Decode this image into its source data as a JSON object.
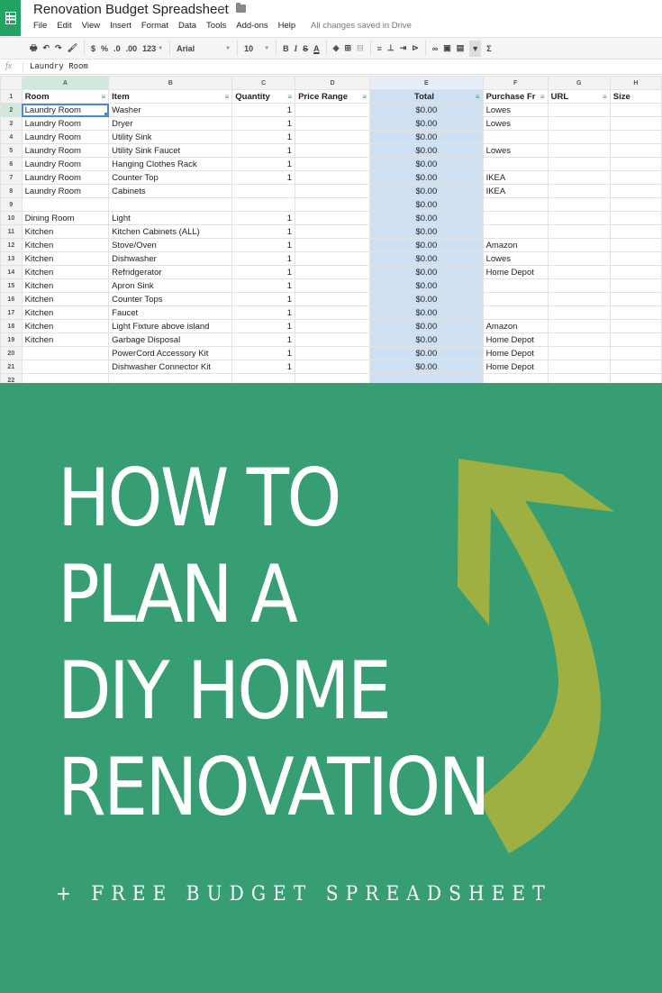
{
  "spreadsheet": {
    "title": "Renovation Budget Spreadsheet",
    "menu": [
      "File",
      "Edit",
      "View",
      "Insert",
      "Format",
      "Data",
      "Tools",
      "Add-ons",
      "Help"
    ],
    "save_status": "All changes saved in Drive",
    "toolbar": {
      "currency": "$",
      "percent": "%",
      "decrease_decimal": ".0",
      "increase_decimal": ".00",
      "more_formats": "123",
      "font": "Arial",
      "font_size": "10",
      "bold": "B",
      "italic": "I",
      "strikethrough": "S",
      "text_color": "A"
    },
    "formula_bar": {
      "fx_label": "fx",
      "value": "Laundry Room"
    },
    "column_letters": [
      "A",
      "B",
      "C",
      "D",
      "E",
      "F",
      "G",
      "H"
    ],
    "headers": [
      "Room",
      "Item",
      "Quantity",
      "Price Range",
      "Total",
      "Purchase Fr",
      "URL",
      "Size"
    ],
    "rows": [
      {
        "n": "2",
        "room": "Laundry Room",
        "item": "Washer",
        "qty": "1",
        "total": "$0.00",
        "from": "Lowes"
      },
      {
        "n": "3",
        "room": "Laundry Room",
        "item": "Dryer",
        "qty": "1",
        "total": "$0.00",
        "from": "Lowes"
      },
      {
        "n": "4",
        "room": "Laundry Room",
        "item": "Utility Sink",
        "qty": "1",
        "total": "$0.00",
        "from": ""
      },
      {
        "n": "5",
        "room": "Laundry Room",
        "item": "Utility Sink Faucet",
        "qty": "1",
        "total": "$0.00",
        "from": "Lowes"
      },
      {
        "n": "6",
        "room": "Laundry Room",
        "item": "Hanging Clothes Rack",
        "qty": "1",
        "total": "$0.00",
        "from": ""
      },
      {
        "n": "7",
        "room": "Laundry Room",
        "item": "Counter Top",
        "qty": "1",
        "total": "$0.00",
        "from": "IKEA"
      },
      {
        "n": "8",
        "room": "Laundry Room",
        "item": "Cabinets",
        "qty": "",
        "total": "$0.00",
        "from": "IKEA"
      },
      {
        "n": "9",
        "room": "",
        "item": "",
        "qty": "",
        "total": "$0.00",
        "from": ""
      },
      {
        "n": "10",
        "room": "Dining Room",
        "item": "Light",
        "qty": "1",
        "total": "$0.00",
        "from": ""
      },
      {
        "n": "11",
        "room": "Kitchen",
        "item": "Kitchen Cabinets (ALL)",
        "qty": "1",
        "total": "$0.00",
        "from": ""
      },
      {
        "n": "12",
        "room": "Kitchen",
        "item": "Stove/Oven",
        "qty": "1",
        "total": "$0.00",
        "from": "Amazon"
      },
      {
        "n": "13",
        "room": "Kitchen",
        "item": "Dishwasher",
        "qty": "1",
        "total": "$0.00",
        "from": "Lowes"
      },
      {
        "n": "14",
        "room": "Kitchen",
        "item": "Refridgerator",
        "qty": "1",
        "total": "$0.00",
        "from": "Home Depot"
      },
      {
        "n": "15",
        "room": "Kitchen",
        "item": "Apron Sink",
        "qty": "1",
        "total": "$0.00",
        "from": ""
      },
      {
        "n": "16",
        "room": "Kitchen",
        "item": "Counter Tops",
        "qty": "1",
        "total": "$0.00",
        "from": ""
      },
      {
        "n": "17",
        "room": "Kitchen",
        "item": "Faucet",
        "qty": "1",
        "total": "$0.00",
        "from": ""
      },
      {
        "n": "18",
        "room": "Kitchen",
        "item": "Light Fixture above island",
        "qty": "1",
        "total": "$0.00",
        "from": "Amazon"
      },
      {
        "n": "19",
        "room": "Kitchen",
        "item": "Garbage Disposal",
        "qty": "1",
        "total": "$0.00",
        "from": "Home Depot"
      },
      {
        "n": "20",
        "room": "",
        "item": "PowerCord Accessory Kit",
        "qty": "1",
        "total": "$0.00",
        "from": "Home Depot"
      },
      {
        "n": "21",
        "room": "",
        "item": "Dishwasher Connector Kit",
        "qty": "1",
        "total": "$0.00",
        "from": "Home Depot"
      },
      {
        "n": "22",
        "room": "",
        "item": "",
        "qty": "",
        "total": "",
        "from": ""
      }
    ]
  },
  "banner": {
    "headline_lines": [
      "HOW TO",
      "PLAN A",
      "DIY HOME",
      "RENOVATION"
    ],
    "subhead": "+ FREE BUDGET SPREADSHEET",
    "colors": {
      "background": "#379e73",
      "arrow": "#9db041",
      "text": "#ffffff"
    }
  }
}
